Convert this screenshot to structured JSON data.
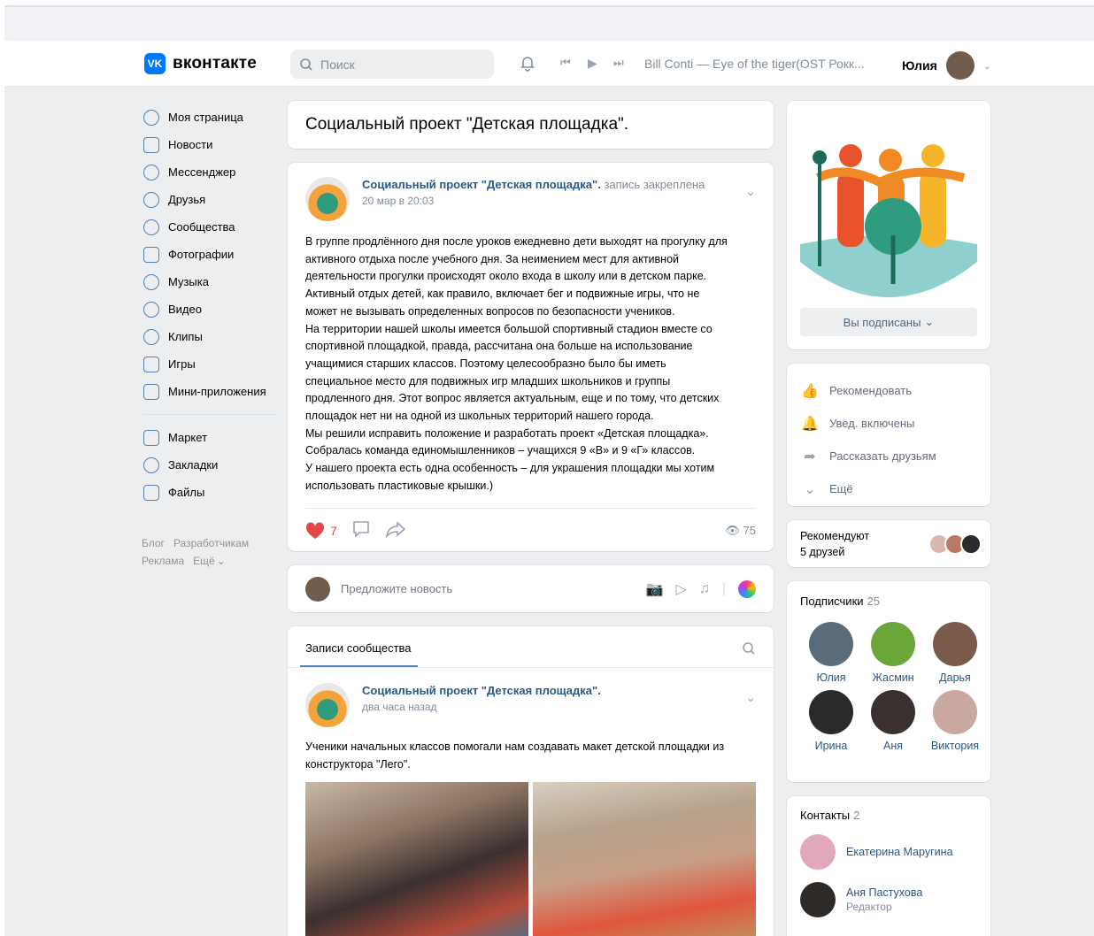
{
  "header": {
    "logo_text": "вконтакте",
    "logo_glyph": "VK",
    "search_placeholder": "Поиск",
    "track": "Bill Conti — Eye of the tiger(OST Рокк...",
    "user_name": "Юлия"
  },
  "sidebar": {
    "items": [
      {
        "label": "Моя страница"
      },
      {
        "label": "Новости"
      },
      {
        "label": "Мессенджер"
      },
      {
        "label": "Друзья"
      },
      {
        "label": "Сообщества"
      },
      {
        "label": "Фотографии"
      },
      {
        "label": "Музыка"
      },
      {
        "label": "Видео"
      },
      {
        "label": "Клипы"
      },
      {
        "label": "Игры"
      },
      {
        "label": "Мини-приложения"
      }
    ],
    "items2": [
      {
        "label": "Маркет"
      },
      {
        "label": "Закладки"
      },
      {
        "label": "Файлы"
      }
    ],
    "footer": {
      "blog": "Блог",
      "dev": "Разработчикам",
      "ads": "Реклама",
      "more": "Ещё"
    }
  },
  "group": {
    "title": "Социальный проект \"Детская площадка\"."
  },
  "pinned_post": {
    "author": "Социальный проект \"Детская площадка\".",
    "pinned": "запись закреплена",
    "date": "20 мар в 20:03",
    "text": "В группе продлённого дня после уроков ежедневно дети выходят на прогулку для\nактивного отдыха после учебного дня. За неимением мест для активной\nдеятельности прогулки происходят около входа в школу или в детском парке.\nАктивный отдых детей, как правило, включает бег и подвижные игры, что не\nможет не вызывать определенных вопросов по безопасности учеников.\nНа территории нашей школы имеется большой спортивный стадион вместе со\nспортивной площадкой, правда, рассчитана она больше на использование\nучащимися старших классов. Поэтому целесообразно было бы иметь\nспециальное место для подвижных игр младших школьников и группы\nпродленного дня. Этот вопрос является актуальным, еще и по тому, что детских\nплощадок нет ни на одной из школьных территорий нашего города.\nМы решили исправить положение и разработать проект «Детская площадка».\nСобралась команда единомышленников – учащихся 9 «В» и 9 «Г» классов.\nУ нашего проекта есть одна особенность – для украшения площадки мы хотим\nиспользовать пластиковые крышки.)",
    "likes": "7",
    "views": "75"
  },
  "suggest": {
    "label": "Предложите новость"
  },
  "feed": {
    "tab": "Записи сообщества",
    "post_author": "Социальный проект \"Детская площадка\".",
    "post_date": "два часа назад",
    "post_text": "Ученики начальных классов помогали нам создавать макет детской площадки из\nконструктора \"Лего\"."
  },
  "right": {
    "subscribed": "Вы подписаны",
    "actions": [
      {
        "label": "Рекомендовать",
        "icon": "thumbs-up-icon"
      },
      {
        "label": "Увед. включены",
        "icon": "bell-check-icon"
      },
      {
        "label": "Рассказать друзьям",
        "icon": "share-icon"
      },
      {
        "label": "Ещё",
        "icon": "chevron-down-icon"
      }
    ],
    "recommend": {
      "line1": "Рекомендуют",
      "line2": "5 друзей"
    },
    "subscribers": {
      "title": "Подписчики",
      "count": "25",
      "people": [
        {
          "name": "Юлия"
        },
        {
          "name": "Жасмин"
        },
        {
          "name": "Дарья"
        },
        {
          "name": "Ирина"
        },
        {
          "name": "Аня"
        },
        {
          "name": "Виктория"
        }
      ]
    },
    "contacts": {
      "title": "Контакты",
      "count": "2",
      "people": [
        {
          "name": "Екатерина Маругина",
          "role": ""
        },
        {
          "name": "Аня Пастухова",
          "role": "Редактор"
        }
      ]
    }
  },
  "colors": {
    "accent": "#0077ff",
    "link": "#2a5885",
    "like": "#e64646"
  }
}
